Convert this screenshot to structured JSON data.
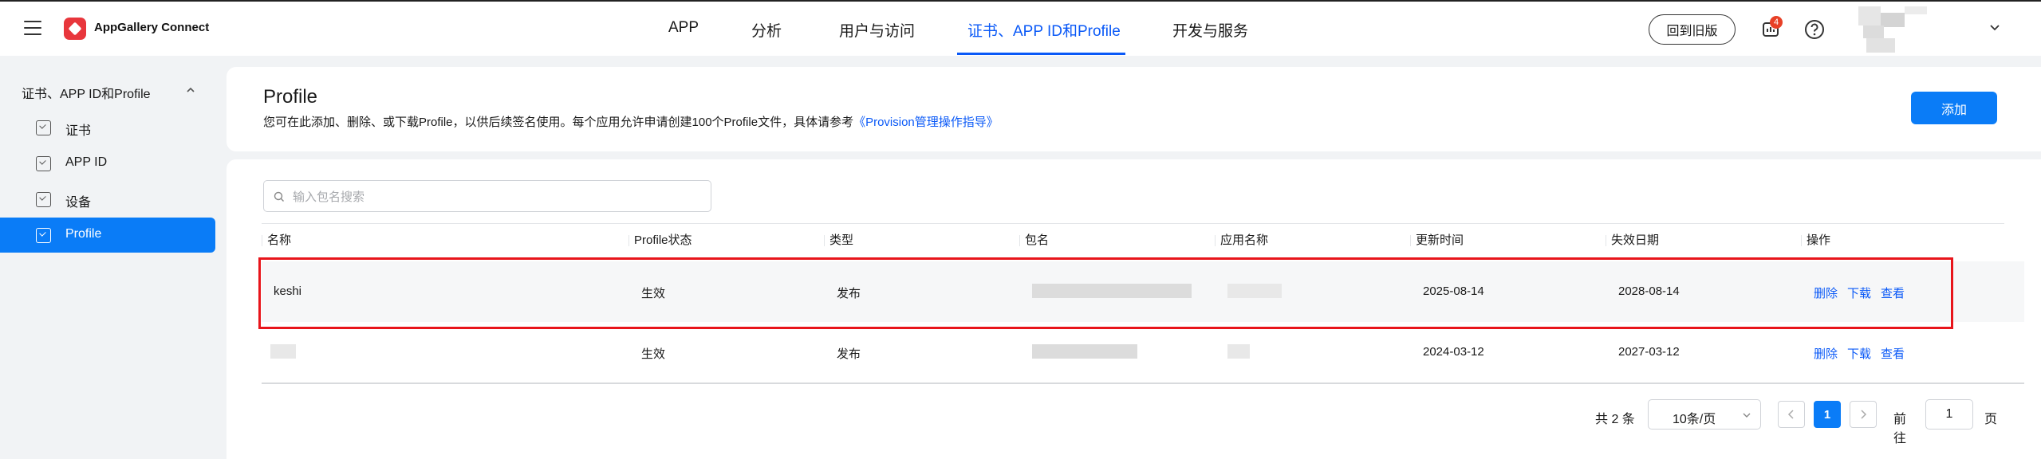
{
  "header": {
    "brand": "AppGallery Connect",
    "nav": [
      "APP",
      "分析",
      "用户与访问",
      "证书、APP ID和Profile",
      "开发与服务"
    ],
    "old_version_label": "回到旧版",
    "message_badge": "4"
  },
  "sidebar": {
    "group_label": "证书、APP ID和Profile",
    "items": [
      "证书",
      "APP ID",
      "设备",
      "Profile"
    ]
  },
  "page": {
    "title": "Profile",
    "description": "您可在此添加、删除、或下载Profile，以供后续签名使用。每个应用允许申请创建100个Profile文件，具体请参考",
    "doc_link": "《Provision管理操作指导》",
    "add_label": "添加"
  },
  "search": {
    "placeholder": "输入包名搜索"
  },
  "table": {
    "columns": [
      "名称",
      "Profile状态",
      "类型",
      "包名",
      "应用名称",
      "更新时间",
      "失效日期",
      "操作"
    ],
    "rows": [
      {
        "name": "keshi",
        "status": "生效",
        "type": "发布",
        "updated": "2025-08-14",
        "expires": "2028-08-14"
      },
      {
        "name": "",
        "status": "生效",
        "type": "发布",
        "updated": "2024-03-12",
        "expires": "2027-03-12"
      }
    ],
    "actions": [
      "删除",
      "下载",
      "查看"
    ]
  },
  "pagination": {
    "total": "共 2 条",
    "page_size": "10条/页",
    "current_page": "1",
    "goto_prefix": "前往",
    "goto_value": "1",
    "goto_suffix": "页"
  },
  "colors": {
    "accent": "#0a7cf7",
    "link": "#0a59f7",
    "highlight": "#e8151b"
  }
}
